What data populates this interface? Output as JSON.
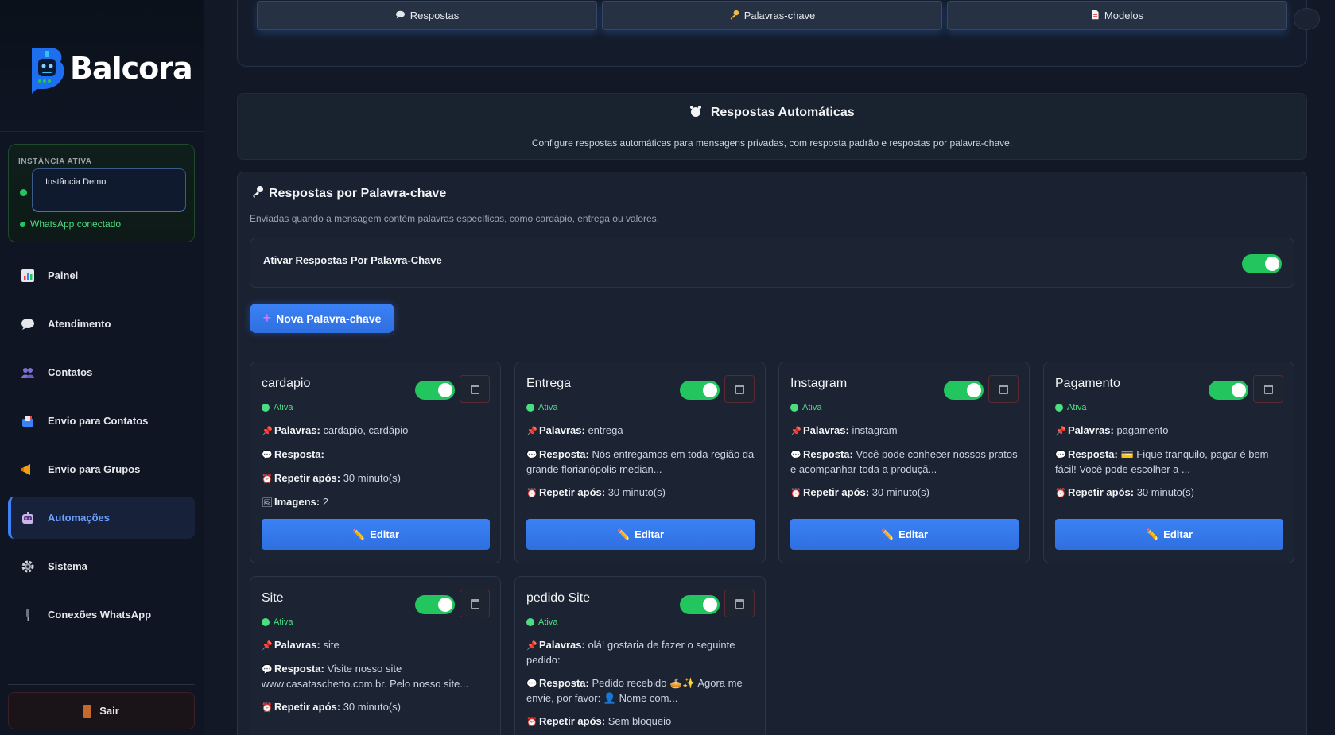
{
  "sidebar": {
    "brand": "Balcora",
    "instance": {
      "label": "INSTÂNCIA ATIVA",
      "selected": "Instância Demo",
      "status": "WhatsApp conectado"
    },
    "nav": [
      {
        "label": "Painel",
        "icon": "chart-icon"
      },
      {
        "label": "Atendimento",
        "icon": "speech-bubble-icon"
      },
      {
        "label": "Contatos",
        "icon": "people-icon"
      },
      {
        "label": "Envio para Contatos",
        "icon": "mailbox-icon"
      },
      {
        "label": "Envio para Grupos",
        "icon": "megaphone-icon"
      },
      {
        "label": "Automações",
        "icon": "robot-icon",
        "active": true
      },
      {
        "label": "Sistema",
        "icon": "gear-icon"
      },
      {
        "label": "Conexões WhatsApp",
        "icon": "plug-icon"
      }
    ],
    "logout": "Sair"
  },
  "tabs": [
    {
      "label": "Respostas",
      "icon": "speech-bubble-icon"
    },
    {
      "label": "Palavras-chave",
      "icon": "key-icon"
    },
    {
      "label": "Modelos",
      "icon": "document-icon"
    }
  ],
  "header": {
    "title": "Respostas Automáticas",
    "subtitle": "Configure respostas automáticas para mensagens privadas, com resposta padrão e respostas por palavra-chave."
  },
  "section": {
    "title": "Respostas por Palavra-chave",
    "description": "Enviadas quando a mensagem contém palavras específicas, como cardápio, entrega ou valores.",
    "toggle_label": "Ativar Respostas Por Palavra-Chave",
    "toggle_on": true,
    "new_button": "Nova Palavra-chave"
  },
  "labels": {
    "status": "Ativa",
    "palavras": "Palavras:",
    "resposta": "Resposta:",
    "repetir": "Repetir após:",
    "imagens": "Imagens:",
    "edit": "Editar"
  },
  "keywords": [
    {
      "name": "cardapio",
      "palavras": "cardapio, cardápio",
      "resposta": "",
      "repetir": "30 minuto(s)",
      "imagens": "2"
    },
    {
      "name": "Entrega",
      "palavras": "entrega",
      "resposta": "Nós entregamos em toda região da grande florianópolis median...",
      "repetir": "30 minuto(s)"
    },
    {
      "name": "Instagram",
      "palavras": "instagram",
      "resposta": "Você pode conhecer nossos pratos e acompanhar toda a produçã...",
      "repetir": "30 minuto(s)"
    },
    {
      "name": "Pagamento",
      "palavras": "pagamento",
      "resposta": "💳 Fique tranquilo, pagar é bem fácil! Você pode escolher a ...",
      "repetir": "30 minuto(s)"
    },
    {
      "name": "Site",
      "palavras": "site",
      "resposta": "Visite nosso site www.casataschetto.com.br. Pelo nosso site...",
      "repetir": "30 minuto(s)"
    },
    {
      "name": "pedido Site",
      "palavras": "olá! gostaria de fazer o seguinte pedido:",
      "resposta": "Pedido recebido 🥧✨ Agora me envie, por favor: 👤 Nome com...",
      "repetir": "Sem bloqueio"
    }
  ],
  "colors": {
    "accent": "#3b82f6",
    "success": "#22c55e",
    "background": "#121826"
  }
}
